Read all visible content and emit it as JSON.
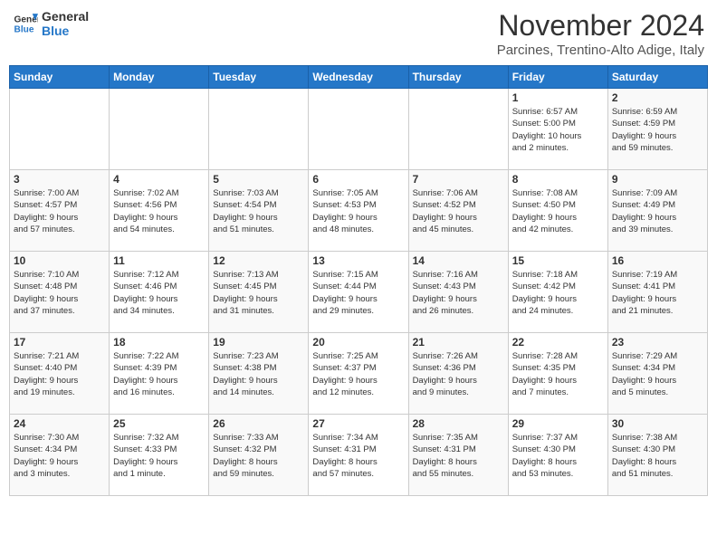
{
  "logo": {
    "line1": "General",
    "line2": "Blue"
  },
  "title": "November 2024",
  "subtitle": "Parcines, Trentino-Alto Adige, Italy",
  "weekdays": [
    "Sunday",
    "Monday",
    "Tuesday",
    "Wednesday",
    "Thursday",
    "Friday",
    "Saturday"
  ],
  "weeks": [
    [
      {
        "day": "",
        "info": ""
      },
      {
        "day": "",
        "info": ""
      },
      {
        "day": "",
        "info": ""
      },
      {
        "day": "",
        "info": ""
      },
      {
        "day": "",
        "info": ""
      },
      {
        "day": "1",
        "info": "Sunrise: 6:57 AM\nSunset: 5:00 PM\nDaylight: 10 hours\nand 2 minutes."
      },
      {
        "day": "2",
        "info": "Sunrise: 6:59 AM\nSunset: 4:59 PM\nDaylight: 9 hours\nand 59 minutes."
      }
    ],
    [
      {
        "day": "3",
        "info": "Sunrise: 7:00 AM\nSunset: 4:57 PM\nDaylight: 9 hours\nand 57 minutes."
      },
      {
        "day": "4",
        "info": "Sunrise: 7:02 AM\nSunset: 4:56 PM\nDaylight: 9 hours\nand 54 minutes."
      },
      {
        "day": "5",
        "info": "Sunrise: 7:03 AM\nSunset: 4:54 PM\nDaylight: 9 hours\nand 51 minutes."
      },
      {
        "day": "6",
        "info": "Sunrise: 7:05 AM\nSunset: 4:53 PM\nDaylight: 9 hours\nand 48 minutes."
      },
      {
        "day": "7",
        "info": "Sunrise: 7:06 AM\nSunset: 4:52 PM\nDaylight: 9 hours\nand 45 minutes."
      },
      {
        "day": "8",
        "info": "Sunrise: 7:08 AM\nSunset: 4:50 PM\nDaylight: 9 hours\nand 42 minutes."
      },
      {
        "day": "9",
        "info": "Sunrise: 7:09 AM\nSunset: 4:49 PM\nDaylight: 9 hours\nand 39 minutes."
      }
    ],
    [
      {
        "day": "10",
        "info": "Sunrise: 7:10 AM\nSunset: 4:48 PM\nDaylight: 9 hours\nand 37 minutes."
      },
      {
        "day": "11",
        "info": "Sunrise: 7:12 AM\nSunset: 4:46 PM\nDaylight: 9 hours\nand 34 minutes."
      },
      {
        "day": "12",
        "info": "Sunrise: 7:13 AM\nSunset: 4:45 PM\nDaylight: 9 hours\nand 31 minutes."
      },
      {
        "day": "13",
        "info": "Sunrise: 7:15 AM\nSunset: 4:44 PM\nDaylight: 9 hours\nand 29 minutes."
      },
      {
        "day": "14",
        "info": "Sunrise: 7:16 AM\nSunset: 4:43 PM\nDaylight: 9 hours\nand 26 minutes."
      },
      {
        "day": "15",
        "info": "Sunrise: 7:18 AM\nSunset: 4:42 PM\nDaylight: 9 hours\nand 24 minutes."
      },
      {
        "day": "16",
        "info": "Sunrise: 7:19 AM\nSunset: 4:41 PM\nDaylight: 9 hours\nand 21 minutes."
      }
    ],
    [
      {
        "day": "17",
        "info": "Sunrise: 7:21 AM\nSunset: 4:40 PM\nDaylight: 9 hours\nand 19 minutes."
      },
      {
        "day": "18",
        "info": "Sunrise: 7:22 AM\nSunset: 4:39 PM\nDaylight: 9 hours\nand 16 minutes."
      },
      {
        "day": "19",
        "info": "Sunrise: 7:23 AM\nSunset: 4:38 PM\nDaylight: 9 hours\nand 14 minutes."
      },
      {
        "day": "20",
        "info": "Sunrise: 7:25 AM\nSunset: 4:37 PM\nDaylight: 9 hours\nand 12 minutes."
      },
      {
        "day": "21",
        "info": "Sunrise: 7:26 AM\nSunset: 4:36 PM\nDaylight: 9 hours\nand 9 minutes."
      },
      {
        "day": "22",
        "info": "Sunrise: 7:28 AM\nSunset: 4:35 PM\nDaylight: 9 hours\nand 7 minutes."
      },
      {
        "day": "23",
        "info": "Sunrise: 7:29 AM\nSunset: 4:34 PM\nDaylight: 9 hours\nand 5 minutes."
      }
    ],
    [
      {
        "day": "24",
        "info": "Sunrise: 7:30 AM\nSunset: 4:34 PM\nDaylight: 9 hours\nand 3 minutes."
      },
      {
        "day": "25",
        "info": "Sunrise: 7:32 AM\nSunset: 4:33 PM\nDaylight: 9 hours\nand 1 minute."
      },
      {
        "day": "26",
        "info": "Sunrise: 7:33 AM\nSunset: 4:32 PM\nDaylight: 8 hours\nand 59 minutes."
      },
      {
        "day": "27",
        "info": "Sunrise: 7:34 AM\nSunset: 4:31 PM\nDaylight: 8 hours\nand 57 minutes."
      },
      {
        "day": "28",
        "info": "Sunrise: 7:35 AM\nSunset: 4:31 PM\nDaylight: 8 hours\nand 55 minutes."
      },
      {
        "day": "29",
        "info": "Sunrise: 7:37 AM\nSunset: 4:30 PM\nDaylight: 8 hours\nand 53 minutes."
      },
      {
        "day": "30",
        "info": "Sunrise: 7:38 AM\nSunset: 4:30 PM\nDaylight: 8 hours\nand 51 minutes."
      }
    ]
  ]
}
